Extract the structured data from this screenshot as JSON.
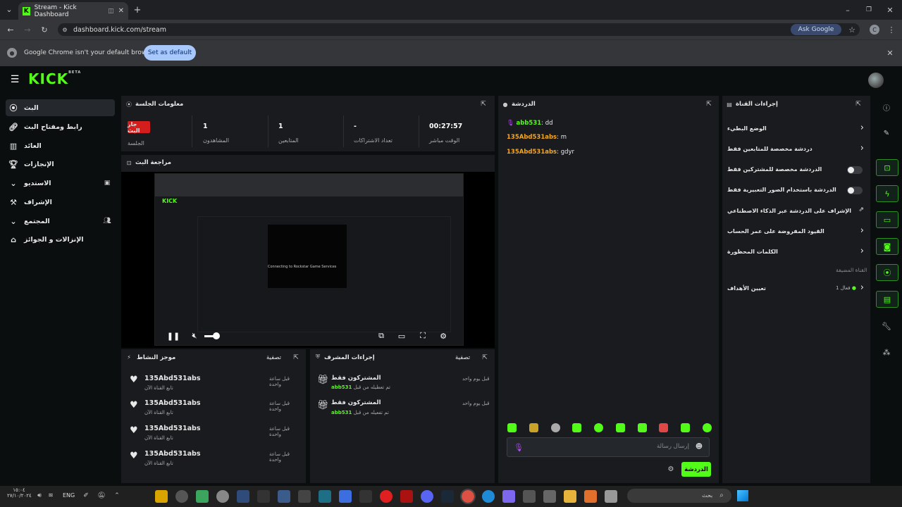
{
  "browser": {
    "tab_title": "Stream - Kick Dashboard",
    "url": "dashboard.kick.com/stream",
    "ask_google": "Ask Google",
    "profile_initial": "C",
    "infobar_text": "Google Chrome isn't your default browser",
    "set_default": "Set as default"
  },
  "brand": {
    "logo": "KICK",
    "beta": "BETA",
    "accent": "#53fc18"
  },
  "sidebar": {
    "items": [
      {
        "label": "البث",
        "icon": "broadcast-icon"
      },
      {
        "label": "رابط ومفتاح البث",
        "icon": "link-icon"
      },
      {
        "label": "العائد",
        "icon": "chart-icon"
      },
      {
        "label": "الإنجازات",
        "icon": "trophy-icon"
      },
      {
        "label": "الاستديو",
        "icon": "studio-icon"
      },
      {
        "label": "الإشراف",
        "icon": "gavel-icon"
      },
      {
        "label": "المجتمع",
        "icon": "community-icon"
      },
      {
        "label": "الإنزالات و الجوائز",
        "icon": "gift-icon"
      }
    ]
  },
  "session": {
    "title": "معلومات الجلسة",
    "badge": "جار البث",
    "session_label": "الجلسة",
    "viewers_label": "المشاهدون",
    "viewers": "1",
    "followers_label": "المتابعين",
    "followers": "1",
    "subs_label": "تعداد الاشتراكات",
    "subs": "-",
    "live_time_label": "الوقت مباشر",
    "live_time": "00:27:57"
  },
  "preview": {
    "title": "مراجعة البث",
    "overlay_text": "Connecting to Rockstar Game Services"
  },
  "chat": {
    "title": "الدردشة",
    "messages": [
      {
        "user": "abb531",
        "text": "dd"
      },
      {
        "user": "135Abd531abs",
        "text": "m"
      },
      {
        "user": "135Abd531abs",
        "text": "gdyr"
      }
    ],
    "input_placeholder": "إرسال رسالة",
    "send_label": "الدردشة"
  },
  "channel": {
    "title": "إجراءات القناة",
    "items": [
      {
        "label": "الوضع البطيء",
        "ctl": "chevron"
      },
      {
        "label": "دردشة مخصصة للمتابعين فقط",
        "ctl": "chevron"
      },
      {
        "label": "الدردشة مخصصة للمشتركين فقط",
        "ctl": "toggle"
      },
      {
        "label": "الدردشة باستخدام الصور التعبيرية فقط",
        "ctl": "toggle"
      },
      {
        "label": "الإشراف على الدردشة عبر الذكاء الاصطناعي",
        "ctl": "external"
      },
      {
        "label": "القيود المفروضة على عمر الحساب",
        "ctl": "chevron"
      },
      {
        "label": "الكلمات المحظورة",
        "ctl": "chevron"
      }
    ],
    "section": "القناة المضيفة",
    "goals": "تعيين الأهداف",
    "goals_status": "فعال 1"
  },
  "activity": {
    "title": "موجز النشاط",
    "filter": "تصفية",
    "items": [
      {
        "user": "135Abd531abs",
        "sub": "تابع القناة الآن",
        "time": "قبل ساعة واحدة"
      },
      {
        "user": "135Abd531abs",
        "sub": "تابع القناة الآن",
        "time": "قبل ساعة واحدة"
      },
      {
        "user": "135Abd531abs",
        "sub": "تابع القناة الآن",
        "time": "قبل ساعة واحدة"
      },
      {
        "user": "135Abd531abs",
        "sub": "تابع القناة الآن",
        "time": "قبل ساعة واحدة"
      }
    ]
  },
  "modactions": {
    "title": "إجراءات المشرف",
    "filter": "تصفية",
    "items": [
      {
        "title": "المشتركون فقط",
        "desc": "تم تعطيله من قبل",
        "user": "abb531",
        "time": "قبل يوم واحد"
      },
      {
        "title": "المشتركون فقط",
        "desc": "تم تفعيله من قبل",
        "user": "abb531",
        "time": "قبل يوم واحد"
      }
    ]
  },
  "taskbar": {
    "lang": "ENG",
    "time": "١٥:٠٤",
    "date": "٢٧/١٠/٢٠٢٤",
    "search": "بحث"
  }
}
